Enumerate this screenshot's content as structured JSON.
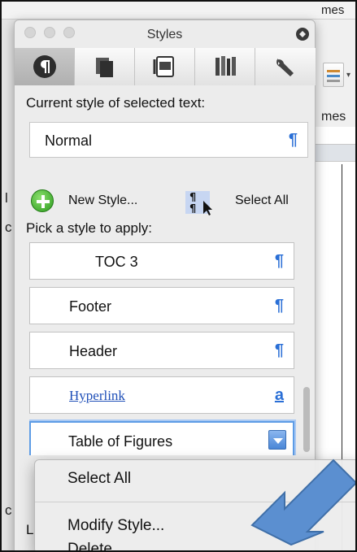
{
  "background": {
    "topbar_text": "mes",
    "ribbon_text": "mes",
    "left_fragments": [
      "l",
      "c",
      "c"
    ]
  },
  "palette": {
    "title": "Styles",
    "toolbar": [
      {
        "icon": "paragraph-icon",
        "active": true
      },
      {
        "icon": "documents-icon",
        "active": false
      },
      {
        "icon": "image-card-icon",
        "active": false
      },
      {
        "icon": "books-icon",
        "active": false
      },
      {
        "icon": "wrench-icon",
        "active": false
      }
    ],
    "current_style_label": "Current style of selected text:",
    "current_style_value": "Normal",
    "current_style_mark": "¶",
    "new_style_label": "New Style...",
    "select_all_label": "Select All",
    "pick_label": "Pick a style to apply:",
    "styles": [
      {
        "name": "TOC 3",
        "mark": "¶",
        "kind": "para"
      },
      {
        "name": "Footer",
        "mark": "¶",
        "kind": "para"
      },
      {
        "name": "Header",
        "mark": "¶",
        "kind": "para"
      },
      {
        "name": "Hyperlink",
        "mark": "a",
        "kind": "char"
      },
      {
        "name": "Table of Figures",
        "mark": "",
        "kind": "selected"
      }
    ],
    "lower_label": "L"
  },
  "context_menu": {
    "items": [
      "Select All",
      "Modify Style...",
      "Delete"
    ]
  },
  "colors": {
    "accent": "#2a6fd6",
    "annotation_arrow": "#5b8fd0"
  }
}
